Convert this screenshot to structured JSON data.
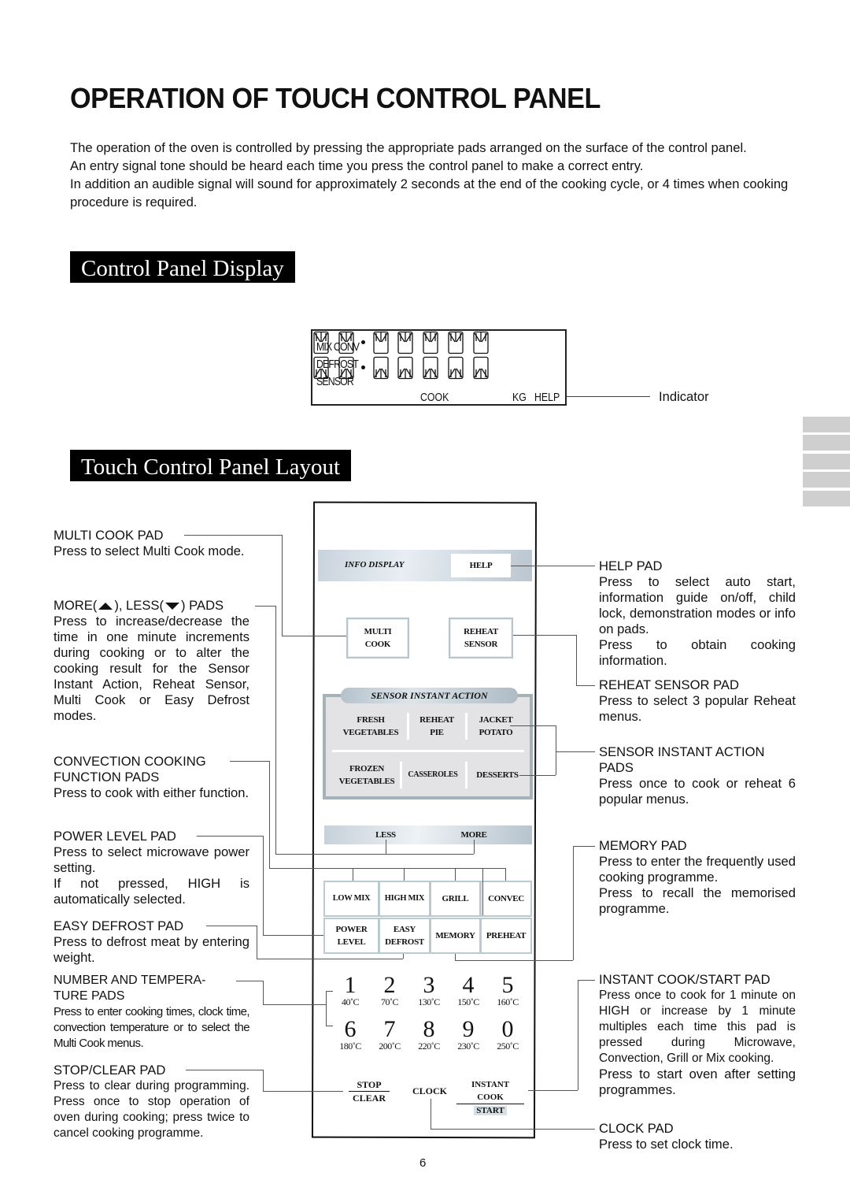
{
  "page": {
    "title": "OPERATION  OF TOUCH CONTROL PANEL",
    "intro": [
      "The operation of the oven is controlled by pressing the appropriate pads arranged on the surface of the control panel.",
      "An entry signal tone should be heard each time you press the control panel to make a correct entry.",
      "In addition an audible signal will sound for approximately 2 seconds at the end of the cooking cycle, or 4 times when cooking procedure is required."
    ],
    "page_number": "6"
  },
  "display_section": {
    "heading": "Control Panel Display",
    "lcd": {
      "modes": [
        "MIX CONV",
        "DEFROST",
        "SENSOR"
      ],
      "cook_label": "COOK",
      "kg_label": "KG",
      "help_label": "HELP"
    },
    "indicator_label": "Indicator"
  },
  "layout_section": {
    "heading": "Touch  Control Panel Layout"
  },
  "panel": {
    "info_display": "INFO DISPLAY",
    "help": "HELP",
    "multi_cook": [
      "MULTI",
      "COOK"
    ],
    "reheat_sensor": [
      "REHEAT",
      "SENSOR"
    ],
    "sensor_instant_action": "SENSOR INSTANT ACTION",
    "sia_pads": [
      [
        "FRESH",
        "VEGETABLES"
      ],
      [
        "REHEAT",
        "PIE"
      ],
      [
        "JACKET",
        "POTATO"
      ],
      [
        "FROZEN",
        "VEGETABLES"
      ],
      [
        "CASSEROLES"
      ],
      [
        "DESSERTS"
      ]
    ],
    "less": "LESS",
    "more": "MORE",
    "function_pads": [
      "LOW MIX",
      "HIGH MIX",
      "GRILL",
      "CONVEC"
    ],
    "second_row_pads": [
      [
        "POWER",
        "LEVEL"
      ],
      [
        "EASY",
        "DEFROST"
      ],
      [
        "MEMORY"
      ],
      [
        "PREHEAT"
      ]
    ],
    "number_pads": [
      {
        "n": "1",
        "t": "40˚C"
      },
      {
        "n": "2",
        "t": "70˚C"
      },
      {
        "n": "3",
        "t": "130˚C"
      },
      {
        "n": "4",
        "t": "150˚C"
      },
      {
        "n": "5",
        "t": "160˚C"
      },
      {
        "n": "6",
        "t": "180˚C"
      },
      {
        "n": "7",
        "t": "200˚C"
      },
      {
        "n": "8",
        "t": "220˚C"
      },
      {
        "n": "9",
        "t": "230˚C"
      },
      {
        "n": "0",
        "t": "250˚C"
      }
    ],
    "stop_clear": [
      "STOP",
      "CLEAR"
    ],
    "clock": "CLOCK",
    "instant_cook_start": [
      "INSTANT COOK",
      "START"
    ]
  },
  "callouts_left": {
    "multi_cook": {
      "h": "MULTI COOK PAD",
      "d": "Press to select Multi Cook mode."
    },
    "more_less": {
      "h_more": "MORE(",
      "h_mid": "), LESS(",
      "h_end": ") PADS",
      "d": "Press to increase/decrease the time in one minute increments during cooking or to alter the cooking result for the Sensor Instant Action, Reheat Sensor, Multi Cook or Easy Defrost modes."
    },
    "convection": {
      "h1": "CONVECTION COOKING",
      "h2": "FUNCTION PADS",
      "d": "Press to cook with either function."
    },
    "power_level": {
      "h": "POWER LEVEL PAD",
      "d1": "Press to select microwave power setting.",
      "d2": "If not pressed, HIGH is automatically selected."
    },
    "easy_defrost": {
      "h": "EASY DEFROST PAD",
      "d": "Press to defrost meat by entering weight."
    },
    "number_temp": {
      "h1": "NUMBER AND TEMPERA-",
      "h2": "TURE PADS",
      "d": "Press to enter cooking times, clock time, convection temperature or to select the Multi Cook menus."
    },
    "stop_clear": {
      "h": "STOP/CLEAR PAD",
      "d": "Press to clear during programming. Press once to stop operation of oven during cooking; press twice to cancel cooking programme."
    }
  },
  "callouts_right": {
    "help": {
      "h": "HELP PAD",
      "d1": "Press to select auto start, information guide on/off, child lock, demonstration modes or info on pads.",
      "d2": "Press to obtain cooking information."
    },
    "reheat_sensor": {
      "h": "REHEAT SENSOR PAD",
      "d": "Press to select 3 popular Reheat menus."
    },
    "sensor_instant": {
      "h1": "SENSOR  INSTANT  ACTION",
      "h2": "PADS",
      "d": "Press once to cook or reheat 6 popular menus."
    },
    "memory": {
      "h": "MEMORY PAD",
      "d1": "Press to enter the frequently used cooking programme.",
      "d2": "Press to recall the memorised programme."
    },
    "instant_cook": {
      "h": "INSTANT COOK/START PAD",
      "d1": "Press once to cook for 1 minute on HIGH or increase by 1 minute multiples each time this pad is pressed during Microwave, Convection, Grill or Mix cooking.",
      "d2": "Press to start oven after setting programmes."
    },
    "clock": {
      "h": "CLOCK PAD",
      "d": "Press to set clock time."
    }
  }
}
